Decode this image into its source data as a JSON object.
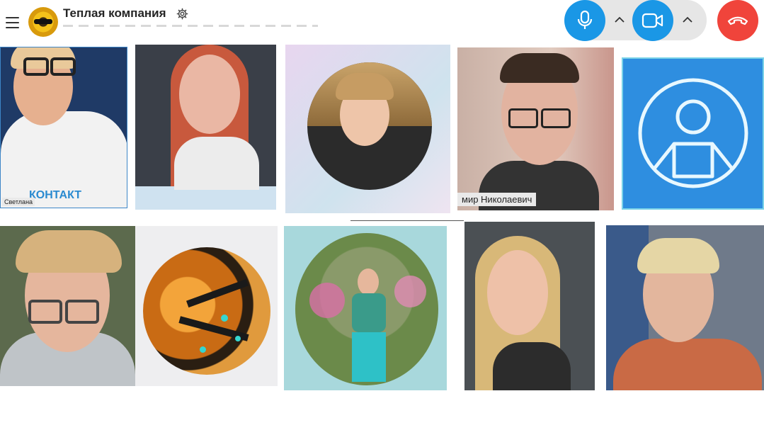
{
  "header": {
    "title": "Теплая компания"
  },
  "controls": {
    "mic": "microphone-icon",
    "camera": "video-camera-icon",
    "hangup": "phone-hangup-icon",
    "accent": "#1a97e6",
    "danger": "#f0443b"
  },
  "tiles": [
    {
      "name": "",
      "small_label": "Светлана"
    },
    {
      "name": ""
    },
    {
      "name": ""
    },
    {
      "name": "мир Николаевич"
    },
    {
      "name": ""
    },
    {
      "name": ""
    },
    {
      "name": ""
    },
    {
      "name": ""
    },
    {
      "name": ""
    },
    {
      "name": ""
    }
  ],
  "video_text": "КОНТАКТ"
}
